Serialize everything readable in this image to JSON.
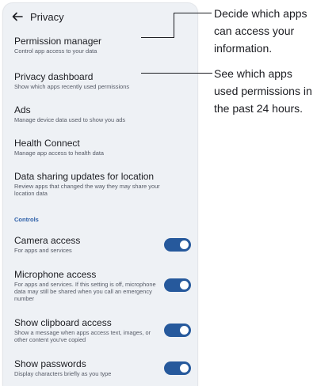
{
  "header": {
    "title": "Privacy"
  },
  "items": [
    {
      "title": "Permission manager",
      "subtitle": "Control app access to your data"
    },
    {
      "title": "Privacy dashboard",
      "subtitle": "Show which apps recently used permissions"
    },
    {
      "title": "Ads",
      "subtitle": "Manage device data used to show you ads"
    },
    {
      "title": "Health Connect",
      "subtitle": "Manage app access to health data"
    },
    {
      "title": "Data sharing updates for location",
      "subtitle": "Review apps that changed the way they may share your location data"
    }
  ],
  "controls": {
    "heading": "Controls",
    "toggles": [
      {
        "title": "Camera access",
        "subtitle": "For apps and services",
        "on": true
      },
      {
        "title": "Microphone access",
        "subtitle": "For apps and services. If this setting is off, microphone data may still be shared when you call an emergency number",
        "on": true
      },
      {
        "title": "Show clipboard access",
        "subtitle": "Show a message when apps access text, images, or other content you've copied",
        "on": true
      },
      {
        "title": "Show passwords",
        "subtitle": "Display characters briefly as you type",
        "on": true
      }
    ]
  },
  "callouts": [
    {
      "lines": [
        "Decide which apps",
        "can access your",
        "information."
      ]
    },
    {
      "lines": [
        "See which apps",
        "used permissions in",
        "the past 24 hours."
      ]
    }
  ],
  "colors": {
    "accent": "#26599c",
    "section": "#2b5ea8",
    "panel": "#eef1f5"
  }
}
